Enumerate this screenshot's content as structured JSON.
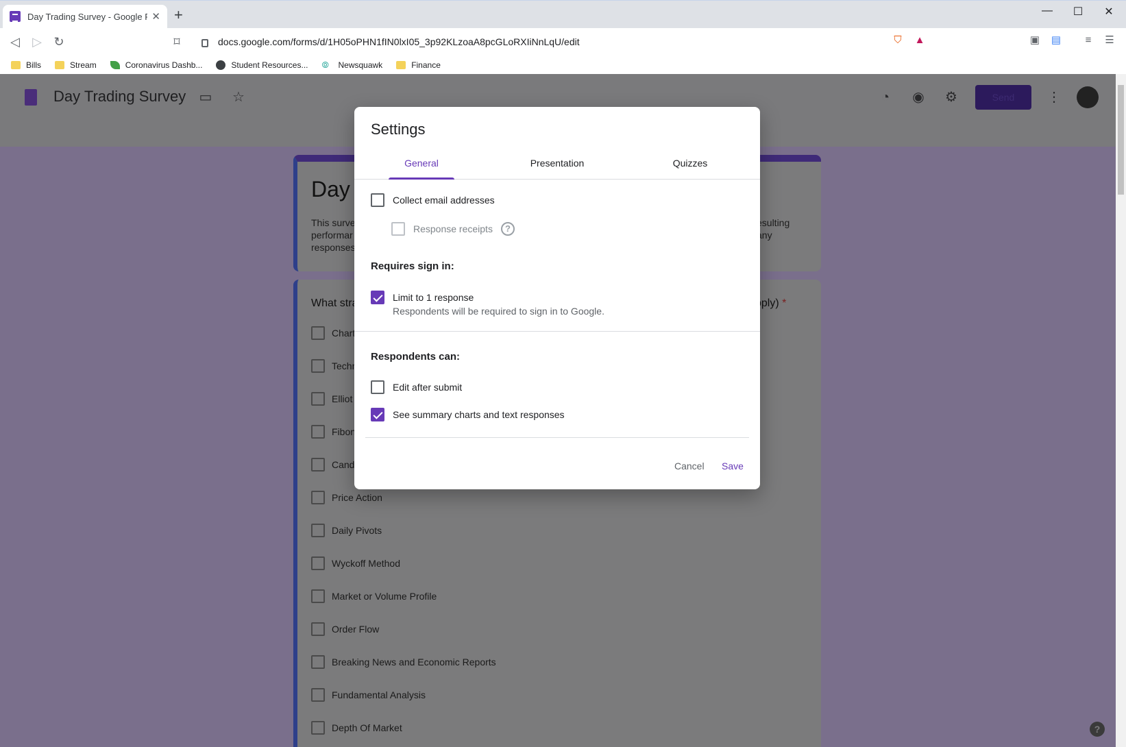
{
  "browser": {
    "tab_title": "Day Trading Survey - Google Form",
    "tab_close": "✕",
    "new_tab": "+",
    "url": "docs.google.com/forms/d/1H05oPHN1fIN0lxI05_3p92KLzoaA8pcGLoRXIiNnLqU/edit",
    "window_controls": [
      "—",
      "☐",
      "✕"
    ],
    "bookmarks": [
      {
        "label": "Bills",
        "icon": "folder-icon"
      },
      {
        "label": "Stream",
        "icon": "folder-icon"
      },
      {
        "label": "Coronavirus Dashb...",
        "icon": "leaf-icon"
      },
      {
        "label": "Student Resources...",
        "icon": "globe-icon"
      },
      {
        "label": "Newsquawk",
        "icon": "wave-icon"
      },
      {
        "label": "Finance",
        "icon": "folder-icon"
      }
    ]
  },
  "forms": {
    "title": "Day Trading Survey",
    "send_label": "Send",
    "card_title": "Day",
    "card_desc_left": [
      "This surve",
      "performar",
      "responses"
    ],
    "card_desc_right": [
      "esulting",
      "any"
    ],
    "question_left": "What stra",
    "question_right": "pply)",
    "required_mark": "*",
    "options": [
      "Chart",
      "Techn",
      "Elliot",
      "Fibon",
      "Cand",
      "Price Action",
      "Daily Pivots",
      "Wyckoff Method",
      "Market or Volume Profile",
      "Order Flow",
      "Breaking News and Economic Reports",
      "Fundamental Analysis",
      "Depth Of Market"
    ],
    "help_fab": "?"
  },
  "dialog": {
    "title": "Settings",
    "tabs": [
      "General",
      "Presentation",
      "Quizzes"
    ],
    "collect_email": "Collect email addresses",
    "response_receipts": "Response receipts",
    "help_glyph": "?",
    "requires_signin_heading": "Requires sign in:",
    "limit_label": "Limit to 1 response",
    "limit_sub": "Respondents will be required to sign in to Google.",
    "respondents_heading": "Respondents can:",
    "edit_after": "Edit after submit",
    "see_summary": "See summary charts and text responses",
    "cancel": "Cancel",
    "save": "Save"
  },
  "colors": {
    "accent": "#673ab7"
  }
}
